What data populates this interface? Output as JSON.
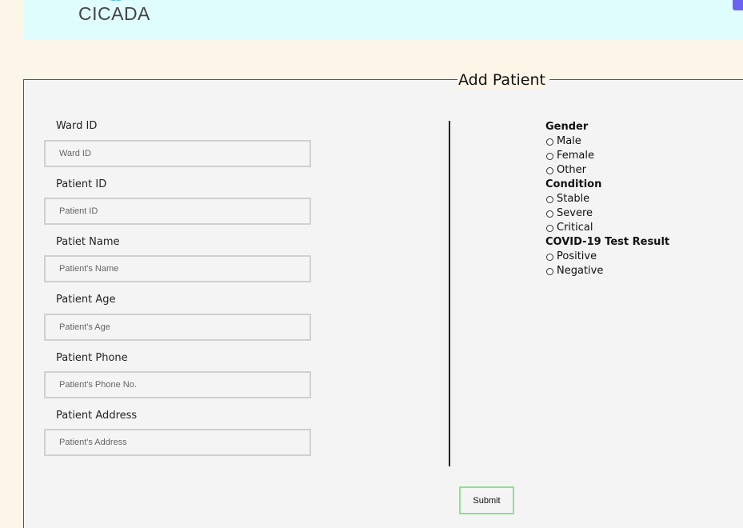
{
  "header": {
    "logo_text": "CICADA"
  },
  "form": {
    "title": "Add Patient",
    "fields": [
      {
        "label": "Ward ID",
        "placeholder": "Ward ID"
      },
      {
        "label": "Patient ID",
        "placeholder": "Patient ID"
      },
      {
        "label": "Patiet Name",
        "placeholder": "Patient's Name"
      },
      {
        "label": "Patient Age",
        "placeholder": "Patient's Age"
      },
      {
        "label": "Patient Phone",
        "placeholder": "Patient's Phone No."
      },
      {
        "label": "Patient Address",
        "placeholder": "Patient's Address"
      }
    ],
    "gender": {
      "title": "Gender",
      "options": [
        "Male",
        "Female",
        "Other"
      ]
    },
    "condition": {
      "title": "Condition",
      "options": [
        "Stable",
        "Severe",
        "Critical"
      ]
    },
    "covid": {
      "title": "COVID-19 Test Result",
      "options": [
        "Positive",
        "Negative"
      ]
    },
    "submit_label": "Submit"
  },
  "colors": {
    "page_bg": "#fdf5e8",
    "header_bg": "#e0fdfd",
    "form_bg": "#f4f4f4",
    "submit_border": "#90e090",
    "corner_button": "#6b63f0"
  }
}
